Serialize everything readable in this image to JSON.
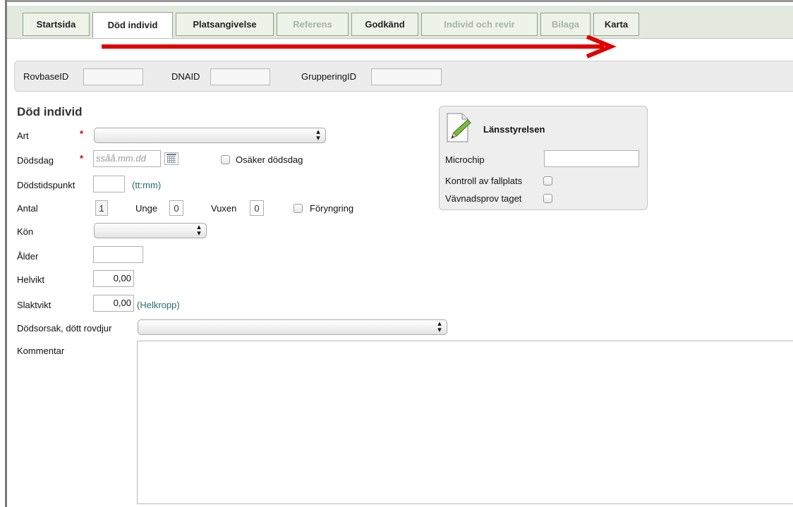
{
  "tabs": [
    {
      "label": "Startsida",
      "state": "normal"
    },
    {
      "label": "Död individ",
      "state": "active"
    },
    {
      "label": "Platsangivelse",
      "state": "normal"
    },
    {
      "label": "Referens",
      "state": "disabled"
    },
    {
      "label": "Godkänd",
      "state": "normal"
    },
    {
      "label": "Individ och revir",
      "state": "disabled"
    },
    {
      "label": "Bilaga",
      "state": "disabled"
    },
    {
      "label": "Karta",
      "state": "normal"
    }
  ],
  "annotation": {
    "arrow_color": "#e00000"
  },
  "ids": {
    "rovbase_label": "RovbaseID",
    "rovbase_value": "",
    "dna_label": "DNAID",
    "dna_value": "",
    "gruppering_label": "GrupperingID",
    "gruppering_value": ""
  },
  "form": {
    "heading": "Död individ",
    "required_marker": "*",
    "art_label": "Art",
    "art_value": "",
    "dodsdag_label": "Dödsdag",
    "dodsdag_placeholder": "ssåå.mm.dd",
    "osaker_label": "Osäker dödsdag",
    "dodstid_label": "Dödstidspunkt",
    "dodstid_value": "",
    "dodstid_hint": "(tt:mm)",
    "antal_label": "Antal",
    "antal_value": "1",
    "unge_label": "Unge",
    "unge_value": "0",
    "vuxen_label": "Vuxen",
    "vuxen_value": "0",
    "foryngring_label": "Föryngring",
    "kon_label": "Kön",
    "kon_value": "",
    "alder_label": "Ålder",
    "alder_value": "",
    "helvikt_label": "Helvikt",
    "helvikt_value": "0,00",
    "slaktvikt_label": "Slaktvikt",
    "slaktvikt_value": "0,00",
    "slaktvikt_hint": "(Helkropp)",
    "dodsorsak_label": "Dödsorsak, dött rovdjur",
    "dodsorsak_value": "",
    "kommentar_label": "Kommentar",
    "kommentar_value": ""
  },
  "lansstyrelsen": {
    "title": "Länsstyrelsen",
    "microchip_label": "Microchip",
    "microchip_value": "",
    "kontroll_label": "Kontroll av fallplats",
    "vavnad_label": "Vävnadsprov taget"
  },
  "icons": {
    "calendar": "calendar-icon",
    "document": "document-edit-icon",
    "select": "updown-arrows-icon"
  }
}
